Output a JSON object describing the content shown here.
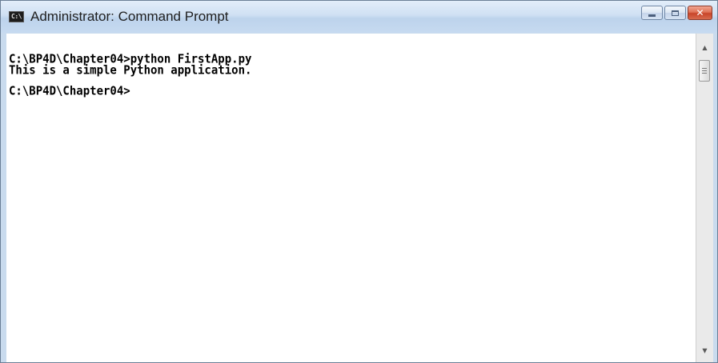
{
  "window": {
    "title": "Administrator: Command Prompt",
    "icon": "cmd-icon",
    "icon_label": "C:\\"
  },
  "caption_buttons": {
    "minimize": "minimize-icon",
    "maximize": "maximize-icon",
    "close": "close-icon",
    "close_glyph": "✕"
  },
  "console": {
    "lines": [
      "C:\\BP4D\\Chapter04>python FirstApp.py",
      "This is a simple Python application.",
      "",
      "C:\\BP4D\\Chapter04>"
    ]
  },
  "scrollbar": {
    "up_arrow": "▲",
    "down_arrow": "▼"
  },
  "colors": {
    "console_background": "#ffffff",
    "console_text": "#000000",
    "titlebar": "#cfe0f3",
    "close_button": "#c8452a"
  }
}
